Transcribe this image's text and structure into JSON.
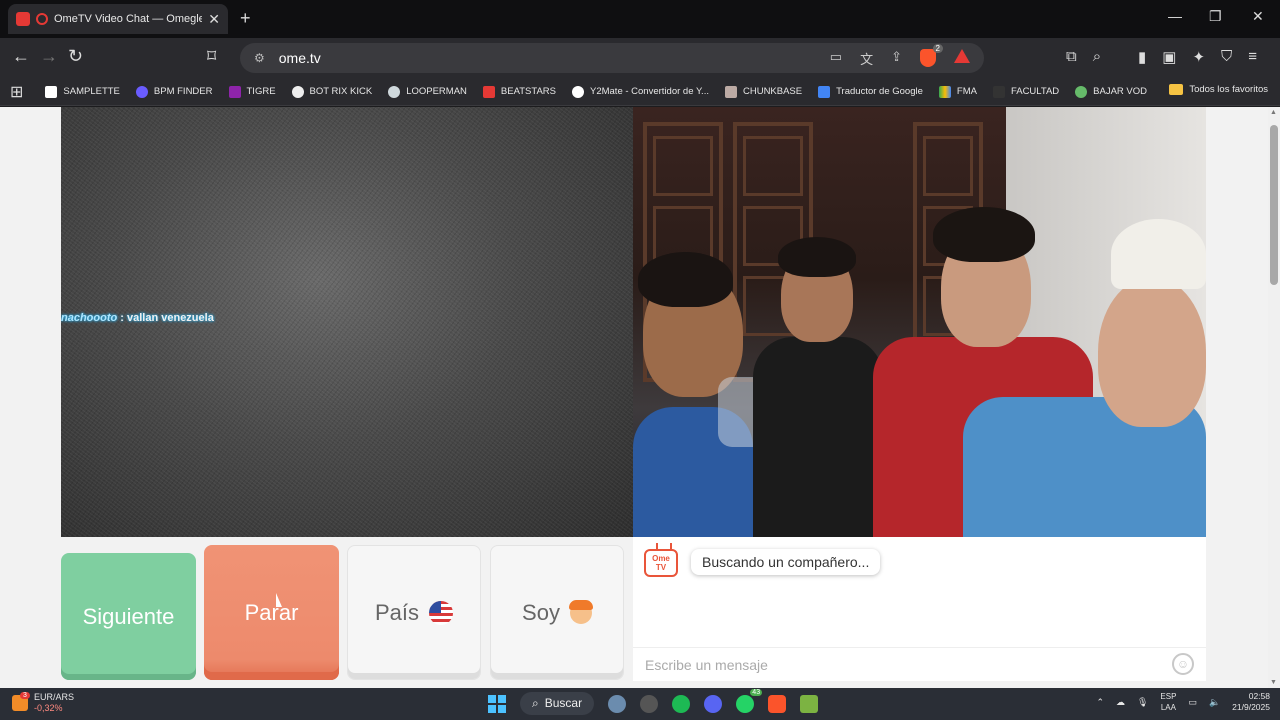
{
  "browser": {
    "tab_title": "OmeTV Video Chat — Omegle Random",
    "url": "ome.tv",
    "brave_badge": "2"
  },
  "bookmarks": [
    {
      "label": "SAMPLETTE",
      "color": "#ffffff"
    },
    {
      "label": "BPM FINDER",
      "color": "#6a5cff"
    },
    {
      "label": "TIGRE",
      "color": "#8e24aa"
    },
    {
      "label": "BOT RIX KICK",
      "color": "#eeeeee"
    },
    {
      "label": "LOOPERMAN",
      "color": "#cfd8dc"
    },
    {
      "label": "BEATSTARS",
      "color": "#e53935"
    },
    {
      "label": "Y2Mate - Convertidor de Y...",
      "color": "#ffffff"
    },
    {
      "label": "CHUNKBASE",
      "color": "#bcaaa4"
    },
    {
      "label": "Traductor de Google",
      "color": "#4285f4"
    },
    {
      "label": "FMA",
      "color": "#34a853"
    },
    {
      "label": "FACULTAD",
      "color": "#333333"
    },
    {
      "label": "BAJAR VOD",
      "color": "#66bb6a"
    }
  ],
  "all_favorites": "Todos los favoritos",
  "overlay": {
    "user": "nachoooto",
    "message": " : vallan venezuela"
  },
  "controls": {
    "next": "Siguiente",
    "stop": "Parar",
    "country": "País",
    "i_am": "Soy"
  },
  "chat": {
    "logo_line1": "Ome",
    "logo_line2": "TV",
    "status": "Buscando un compañero...",
    "input_placeholder": "Escribe un mensaje"
  },
  "taskbar": {
    "stock_name": "EUR/ARS",
    "stock_change": "-0,32%",
    "stock_badge": "3",
    "search": "Buscar",
    "whatsapp_badge": "43",
    "lang_top": "ESP",
    "lang_bottom": "LAA",
    "time": "02:58",
    "date": "21/9/2025"
  },
  "colors": {
    "next_button": "#7fcfa0",
    "stop_button": "#ed8a6c",
    "brand_orange": "#e9553a"
  }
}
